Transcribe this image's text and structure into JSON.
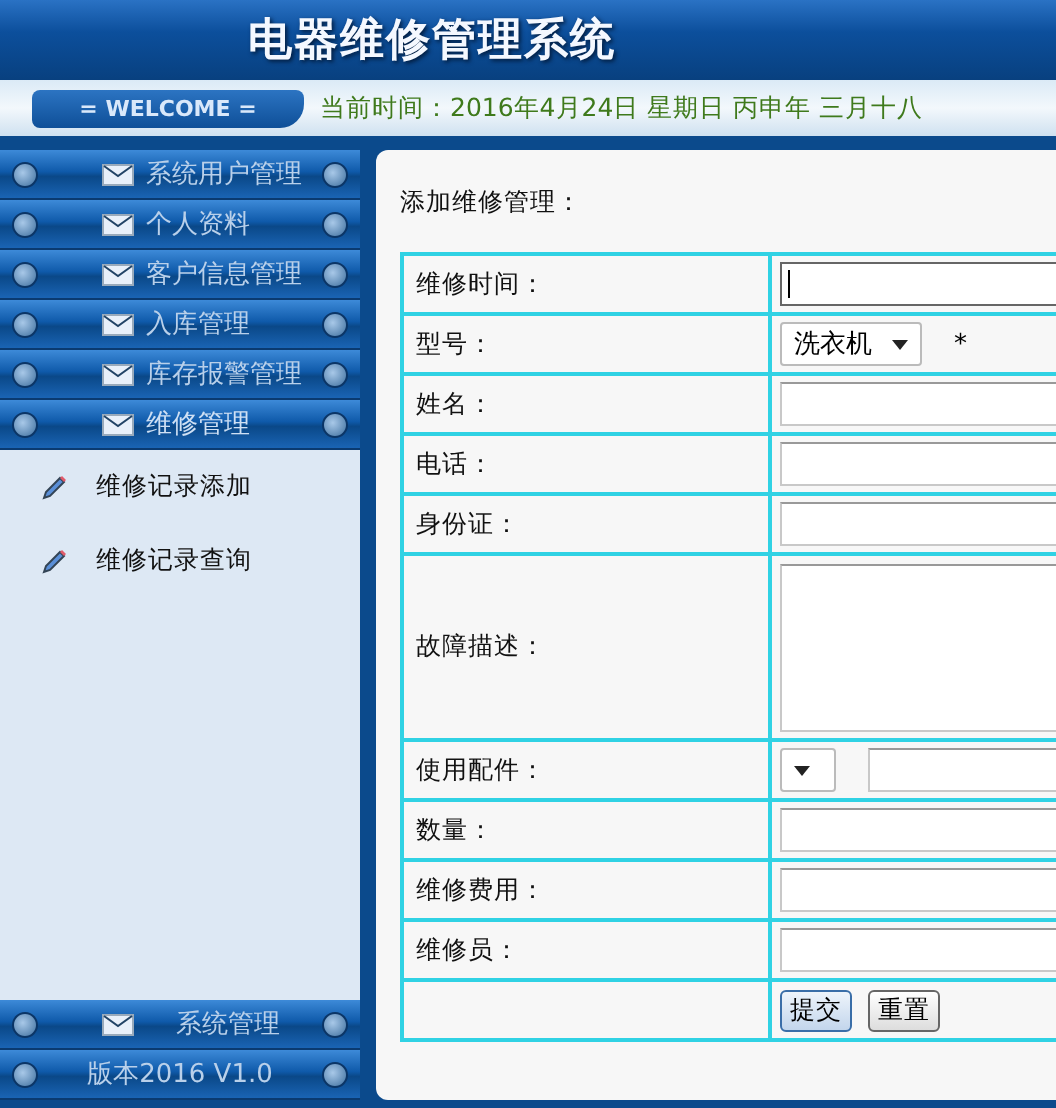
{
  "header": {
    "title": "电器维修管理系统"
  },
  "welcome_bar": {
    "badge": "= WELCOME =",
    "datetime": "当前时间：2016年4月24日 星期日 丙申年 三月十八"
  },
  "sidebar": {
    "menu": [
      {
        "label": "系统用户管理",
        "expanded": false
      },
      {
        "label": "个人资料",
        "expanded": false
      },
      {
        "label": "客户信息管理",
        "expanded": false
      },
      {
        "label": "入库管理",
        "expanded": false
      },
      {
        "label": "库存报警管理",
        "expanded": false
      },
      {
        "label": "维修管理",
        "expanded": true,
        "children": [
          {
            "label": "维修记录添加"
          },
          {
            "label": "维修记录查询"
          }
        ]
      }
    ],
    "footer_menu": [
      {
        "label": "系统管理",
        "kind": "menu"
      },
      {
        "label": "版本2016 V1.0",
        "kind": "version"
      }
    ]
  },
  "form": {
    "title": "添加维修管理：",
    "fields": [
      {
        "label": "维修时间：",
        "kind": "text",
        "focused": true
      },
      {
        "label": "型号：",
        "kind": "select",
        "value": "洗衣机",
        "note": "*"
      },
      {
        "label": "姓名：",
        "kind": "text",
        "focused": false
      },
      {
        "label": "电话：",
        "kind": "text",
        "focused": false
      },
      {
        "label": "身份证：",
        "kind": "text",
        "focused": false
      },
      {
        "label": "故障描述：",
        "kind": "textarea"
      },
      {
        "label": "使用配件：",
        "kind": "select_text"
      },
      {
        "label": "数量：",
        "kind": "text",
        "focused": false
      },
      {
        "label": "维修费用：",
        "kind": "text",
        "focused": false
      },
      {
        "label": "维修员：",
        "kind": "text",
        "focused": false
      }
    ],
    "buttons": [
      "提交",
      "重置"
    ]
  }
}
